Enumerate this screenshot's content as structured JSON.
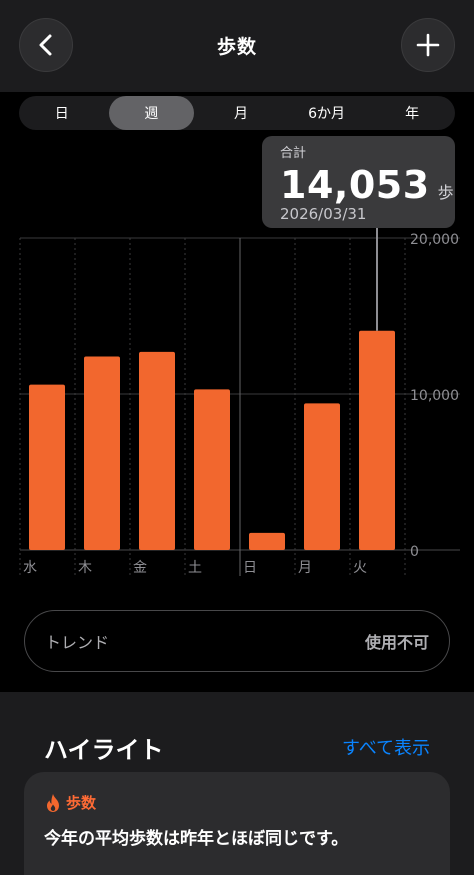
{
  "header": {
    "title": "歩数",
    "back_icon": "chevron-left-icon",
    "add_icon": "plus-icon"
  },
  "tabs": [
    {
      "label": "日",
      "active": false
    },
    {
      "label": "週",
      "active": true
    },
    {
      "label": "月",
      "active": false
    },
    {
      "label": "6か月",
      "active": false
    },
    {
      "label": "年",
      "active": false
    }
  ],
  "tooltip": {
    "label": "合計",
    "value": "14,053",
    "unit": "歩",
    "date": "2026/03/31"
  },
  "chart_data": {
    "type": "bar",
    "categories": [
      "水",
      "木",
      "金",
      "土",
      "日",
      "月",
      "火"
    ],
    "values": [
      10600,
      12400,
      12700,
      10300,
      1100,
      9400,
      14053
    ],
    "y_ticks": [
      "20,000",
      "10,000",
      "0"
    ],
    "ylim": [
      0,
      20000
    ],
    "selected_index": 6,
    "bar_color": "#f2672e"
  },
  "trend": {
    "label": "トレンド",
    "status": "使用不可"
  },
  "highlights": {
    "title": "ハイライト",
    "show_all": "すべて表示",
    "card": {
      "icon": "flame-icon",
      "category": "歩数",
      "text": "今年の平均歩数は昨年とほぼ同じです。"
    }
  },
  "colors": {
    "accent": "#f2672e",
    "link": "#0a84ff"
  }
}
